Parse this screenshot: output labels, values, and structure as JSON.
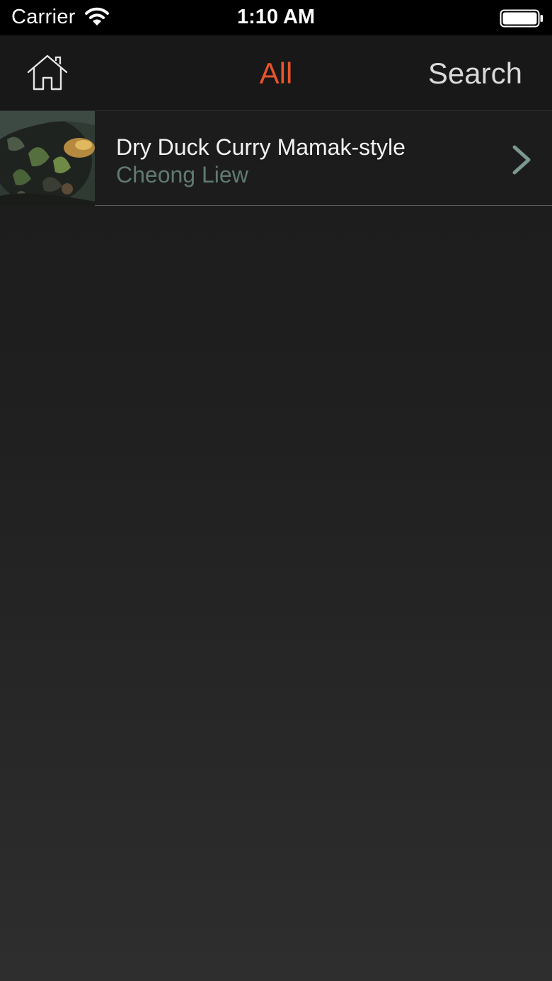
{
  "status_bar": {
    "carrier": "Carrier",
    "time": "1:10 AM",
    "icons": [
      "wifi-icon",
      "battery-icon"
    ]
  },
  "nav": {
    "home_icon": "home-icon",
    "title": "All",
    "search_label": "Search",
    "title_color": "#e8532b"
  },
  "list": {
    "items": [
      {
        "title": "Dry Duck Curry Mamak-style",
        "subtitle": "Cheong Liew",
        "thumbnail": "recipe-photo",
        "accessory": "chevron-right-icon"
      }
    ]
  },
  "colors": {
    "accent": "#e8532b",
    "subtitle": "#5f7a73",
    "background": "#1f1f1f"
  }
}
